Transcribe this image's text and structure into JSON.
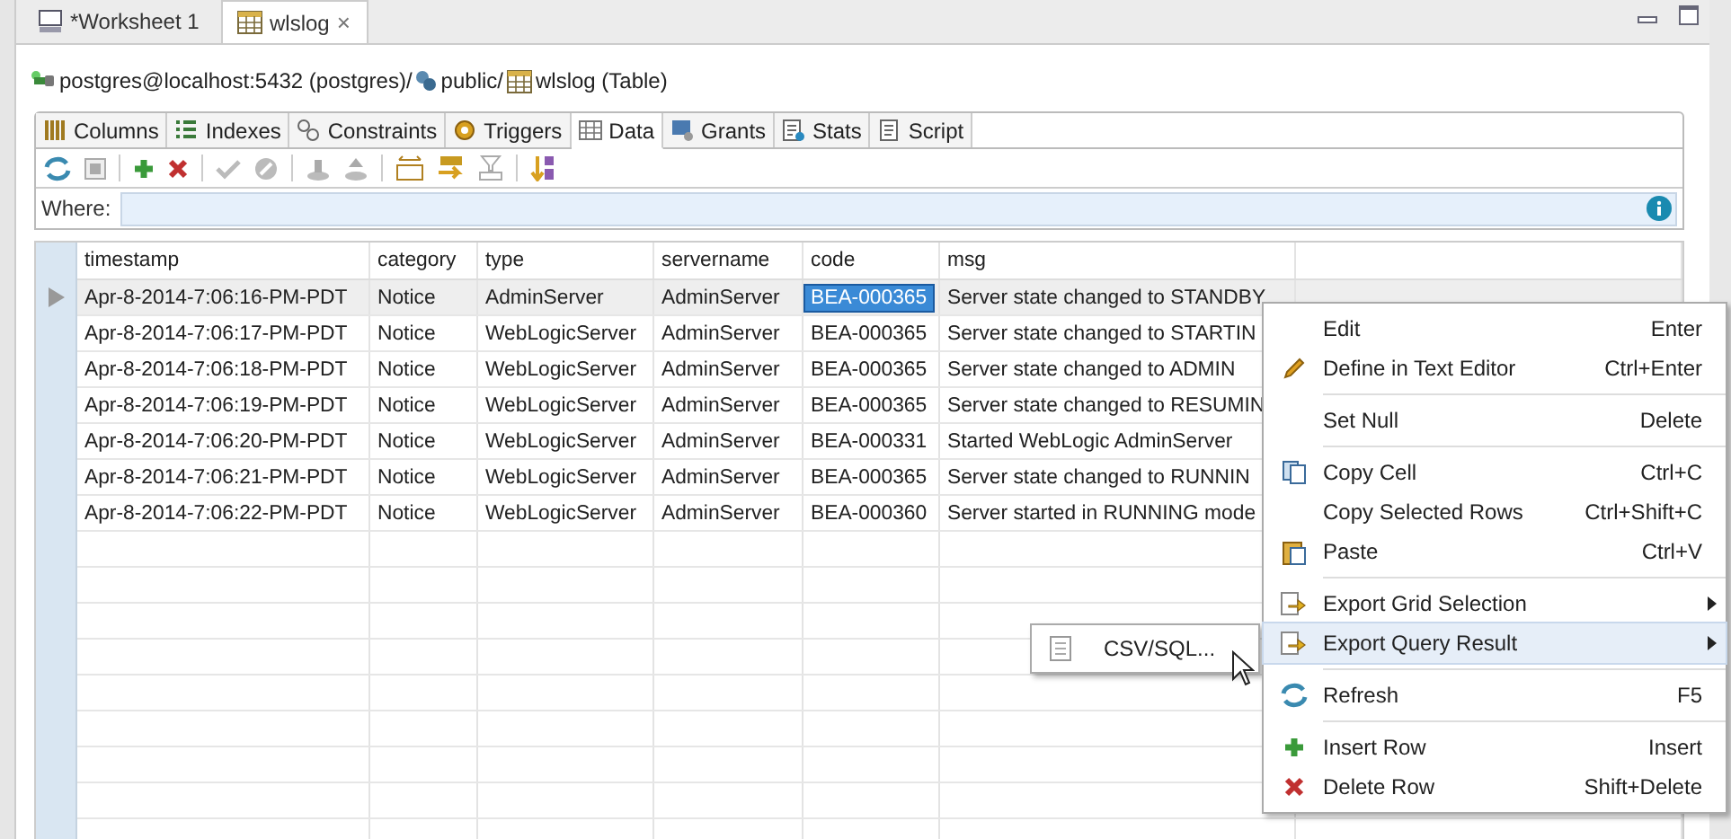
{
  "editor_tabs": [
    {
      "label": "*Worksheet 1",
      "selected": false,
      "closable": false
    },
    {
      "label": "wlslog",
      "selected": true,
      "closable": true
    }
  ],
  "close_glyph": "×",
  "breadcrumb": [
    "postgres@localhost:5432 (postgres)/",
    "public/",
    "wlslog (Table)"
  ],
  "sub_tabs": [
    {
      "label": "Columns",
      "selected": false
    },
    {
      "label": "Indexes",
      "selected": false
    },
    {
      "label": "Constraints",
      "selected": false
    },
    {
      "label": "Triggers",
      "selected": false
    },
    {
      "label": "Data",
      "selected": true
    },
    {
      "label": "Grants",
      "selected": false
    },
    {
      "label": "Stats",
      "selected": false
    },
    {
      "label": "Script",
      "selected": false
    }
  ],
  "where": {
    "label": "Where:"
  },
  "table": {
    "columns": [
      "timestamp",
      "category",
      "type",
      "servername",
      "code",
      "msg"
    ],
    "rows": [
      {
        "selected": true,
        "cells": [
          {
            "text": "Apr-8-2014-7:06:16-PM-PDT",
            "selected": false
          },
          {
            "text": "Notice",
            "selected": false
          },
          {
            "text": "AdminServer",
            "selected": false
          },
          {
            "text": "AdminServer",
            "selected": false
          },
          {
            "text": "BEA-000365",
            "selected": true
          },
          {
            "text": "Server state changed to STANDBY",
            "selected": false
          }
        ]
      },
      {
        "selected": false,
        "cells": [
          {
            "text": "Apr-8-2014-7:06:17-PM-PDT",
            "selected": false
          },
          {
            "text": "Notice",
            "selected": false
          },
          {
            "text": "WebLogicServer",
            "selected": false
          },
          {
            "text": "AdminServer",
            "selected": false
          },
          {
            "text": "BEA-000365",
            "selected": false
          },
          {
            "text": "Server state changed to STARTIN",
            "selected": false
          }
        ]
      },
      {
        "selected": false,
        "cells": [
          {
            "text": "Apr-8-2014-7:06:18-PM-PDT",
            "selected": false
          },
          {
            "text": "Notice",
            "selected": false
          },
          {
            "text": "WebLogicServer",
            "selected": false
          },
          {
            "text": "AdminServer",
            "selected": false
          },
          {
            "text": "BEA-000365",
            "selected": false
          },
          {
            "text": "Server state changed to ADMIN",
            "selected": false
          }
        ]
      },
      {
        "selected": false,
        "cells": [
          {
            "text": "Apr-8-2014-7:06:19-PM-PDT",
            "selected": false
          },
          {
            "text": "Notice",
            "selected": false
          },
          {
            "text": "WebLogicServer",
            "selected": false
          },
          {
            "text": "AdminServer",
            "selected": false
          },
          {
            "text": "BEA-000365",
            "selected": false
          },
          {
            "text": "Server state changed to RESUMIN",
            "selected": false
          }
        ]
      },
      {
        "selected": false,
        "cells": [
          {
            "text": "Apr-8-2014-7:06:20-PM-PDT",
            "selected": false
          },
          {
            "text": "Notice",
            "selected": false
          },
          {
            "text": "WebLogicServer",
            "selected": false
          },
          {
            "text": "AdminServer",
            "selected": false
          },
          {
            "text": "BEA-000331",
            "selected": false
          },
          {
            "text": "Started WebLogic AdminServer",
            "selected": false
          }
        ]
      },
      {
        "selected": false,
        "cells": [
          {
            "text": "Apr-8-2014-7:06:21-PM-PDT",
            "selected": false
          },
          {
            "text": "Notice",
            "selected": false
          },
          {
            "text": "WebLogicServer",
            "selected": false
          },
          {
            "text": "AdminServer",
            "selected": false
          },
          {
            "text": "BEA-000365",
            "selected": false
          },
          {
            "text": "Server state changed to RUNNIN",
            "selected": false
          }
        ]
      },
      {
        "selected": false,
        "cells": [
          {
            "text": "Apr-8-2014-7:06:22-PM-PDT",
            "selected": false
          },
          {
            "text": "Notice",
            "selected": false
          },
          {
            "text": "WebLogicServer",
            "selected": false
          },
          {
            "text": "AdminServer",
            "selected": false
          },
          {
            "text": "BEA-000360",
            "selected": false
          },
          {
            "text": "Server started in RUNNING mode",
            "selected": false
          }
        ]
      }
    ]
  },
  "context_menu": {
    "groups": [
      [
        {
          "label": "Edit",
          "shortcut": "Enter",
          "submenu": false,
          "selected": false
        },
        {
          "label": "Define in Text Editor",
          "shortcut": "Ctrl+Enter",
          "submenu": false,
          "selected": false
        }
      ],
      [
        {
          "label": "Set Null",
          "shortcut": "Delete",
          "submenu": false,
          "selected": false
        }
      ],
      [
        {
          "label": "Copy Cell",
          "shortcut": "Ctrl+C",
          "submenu": false,
          "selected": false
        },
        {
          "label": "Copy Selected Rows",
          "shortcut": "Ctrl+Shift+C",
          "submenu": false,
          "selected": false
        },
        {
          "label": "Paste",
          "shortcut": "Ctrl+V",
          "submenu": false,
          "selected": false
        }
      ],
      [
        {
          "label": "Export Grid Selection",
          "submenu": true,
          "selected": false
        },
        {
          "label": "Export Query Result",
          "submenu": true,
          "selected": true
        }
      ],
      [
        {
          "label": "Refresh",
          "shortcut": "F5",
          "submenu": false,
          "selected": false
        }
      ],
      [
        {
          "label": "Insert Row",
          "shortcut": "Insert",
          "submenu": false,
          "selected": false
        },
        {
          "label": "Delete Row",
          "shortcut": "Shift+Delete",
          "submenu": false,
          "selected": false
        }
      ]
    ]
  },
  "submenu": {
    "items": [
      {
        "label": "CSV/SQL...",
        "selected": false
      }
    ]
  }
}
